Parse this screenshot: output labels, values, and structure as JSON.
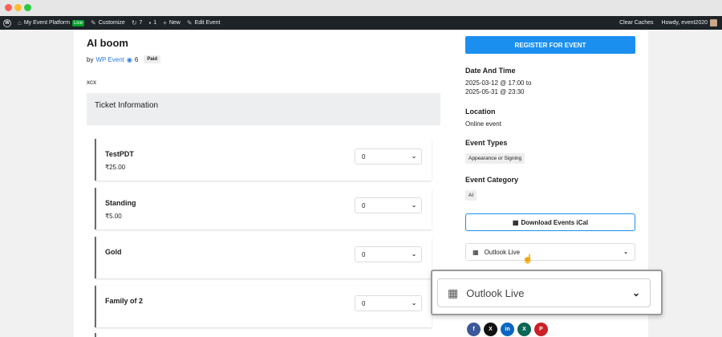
{
  "adminbar": {
    "site_name": "My Event Platform",
    "live_badge": "Live",
    "customize": "Customize",
    "updates_count": "7",
    "comments_count": "1",
    "new_label": "New",
    "edit_label": "Edit Event",
    "clear_caches": "Clear Caches",
    "howdy": "Howdy, event2020"
  },
  "event": {
    "title": "AI boom",
    "by_prefix": "by",
    "author": "WP Event",
    "views": "6",
    "paid_badge": "Paid",
    "description": "xcx"
  },
  "tickets": {
    "heading": "Ticket Information",
    "items": [
      {
        "name": "TestPDT",
        "price": "₹25.00",
        "qty": "0"
      },
      {
        "name": "Standing",
        "price": "₹5.00",
        "qty": "0"
      },
      {
        "name": "Gold",
        "price": "",
        "qty": "0"
      },
      {
        "name": "Family of 2",
        "price": "",
        "qty": "0"
      }
    ]
  },
  "sidebar": {
    "register_label": "REGISTER FOR EVENT",
    "date_label": "Date And Time",
    "date_start": "2025-03-12 @ 17:00 to",
    "date_end": "2025-05-31 @ 23:30",
    "location_label": "Location",
    "location_value": "Online event",
    "types_label": "Event Types",
    "type_tag": "Appearance or Signing",
    "category_label": "Event Category",
    "category_tag": "AI",
    "ical_label": "Download Events iCal",
    "calendar_select": "Outlook Live"
  },
  "share_icons": [
    {
      "name": "facebook-icon",
      "glyph": "f",
      "color": "#3b5998"
    },
    {
      "name": "x-icon",
      "glyph": "X",
      "color": "#111111"
    },
    {
      "name": "linkedin-icon",
      "glyph": "in",
      "color": "#0a66c2"
    },
    {
      "name": "xing-icon",
      "glyph": "X",
      "color": "#0b6655"
    },
    {
      "name": "pinterest-icon",
      "glyph": "P",
      "color": "#cb2027"
    }
  ],
  "zoom": {
    "calendar_select": "Outlook Live"
  },
  "colors": {
    "primary": "#1a8ff0",
    "adminbar": "#1d2327"
  }
}
